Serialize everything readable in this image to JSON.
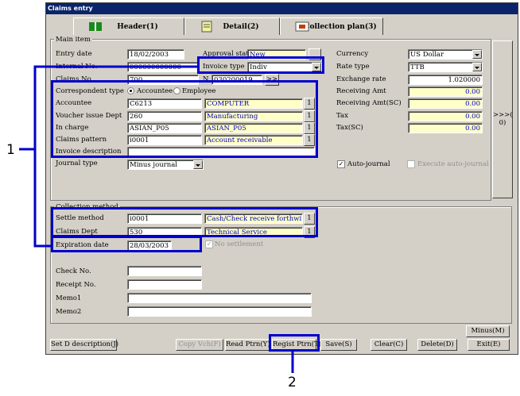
{
  "window": {
    "title": "Claims entry"
  },
  "tabs": [
    {
      "label": "Header(1)"
    },
    {
      "label": "Detail(2)"
    },
    {
      "label": "Collection plan(3)"
    }
  ],
  "main_item": {
    "legend": "Main item",
    "entry_date": {
      "label": "Entry date",
      "value": "18/02/2003"
    },
    "internal_no": {
      "label": "Internal No.",
      "value": "000000000000"
    },
    "claims_no": {
      "label": "Claims No.",
      "value": "700"
    },
    "approval_status": {
      "label": "Approval status",
      "value": "New"
    },
    "invoice_type": {
      "label": "Invoice type",
      "value": "Indiv"
    },
    "n_field": {
      "label": "N",
      "value": "030200019",
      "button": ">>"
    },
    "correspondent_type": {
      "label": "Correspondent type",
      "option1": "Accountee",
      "option2": "Employee"
    },
    "accountee": {
      "label": "Accountee",
      "code": "C6213",
      "name": "COMPUTER"
    },
    "voucher_dept": {
      "label": "Voucher issue Dept",
      "code": "260",
      "name": "Manufacturing"
    },
    "in_charge": {
      "label": "In charge",
      "code": "ASIAN_P05",
      "name": "ASIAN_P05"
    },
    "claims_pattern": {
      "label": "Claims pattern",
      "code": "i0001",
      "name": "Account receivable"
    },
    "invoice_description": {
      "label": "Invoice description",
      "value": ""
    },
    "journal_type": {
      "label": "Journal type",
      "value": "Minus journal"
    },
    "lookup_button": "1",
    "currency": {
      "label": "Currency",
      "value": "US Dollar"
    },
    "rate_type": {
      "label": "Rate type",
      "value": "TTB"
    },
    "exchange_rate": {
      "label": "Exchange rate",
      "value": "1.020000"
    },
    "receiving_amt": {
      "label": "Receiving Amt",
      "value": "0.00"
    },
    "receiving_amt_sc": {
      "label": "Receiving Amt(SC)",
      "value": "0.00"
    },
    "tax": {
      "label": "Tax",
      "value": "0.00"
    },
    "tax_sc": {
      "label": "Tax(SC)",
      "value": "0.00"
    },
    "auto_journal": "Auto-journal",
    "execute_auto_journal": "Execute auto-journal",
    "side_button": ">>>(",
    "side_button2": "0)"
  },
  "collection_method": {
    "legend": "Collection method",
    "settle_method": {
      "label": "Settle method",
      "code": "i0001",
      "name": "Cash/Check receive forthwith"
    },
    "claims_dept": {
      "label": "Claims Dept",
      "code": "530",
      "name": "Technical Service"
    },
    "expiration_date": {
      "label": "Expiration date",
      "value": "28/03/2003"
    },
    "no_settlement": "No settlement",
    "check_no": {
      "label": "Check No.",
      "value": ""
    },
    "receipt_no": {
      "label": "Receipt No.",
      "value": ""
    },
    "memo1": {
      "label": "Memo1",
      "value": ""
    },
    "memo2": {
      "label": "Memo2",
      "value": ""
    }
  },
  "footer": {
    "minus": "Minus(M)",
    "set_d_description": "Set D description(J)",
    "copy_vch": "Copy Vch(F)",
    "read_ptrn": "Read Ptrn(Y)",
    "regist_ptrn": "Regist Ptrn(T)",
    "save": "Save(S)",
    "clear": "Clear(C)",
    "delete": "Delete(D)",
    "exit": "Exit(E)"
  },
  "callouts": {
    "c1": "1",
    "c2": "2"
  }
}
